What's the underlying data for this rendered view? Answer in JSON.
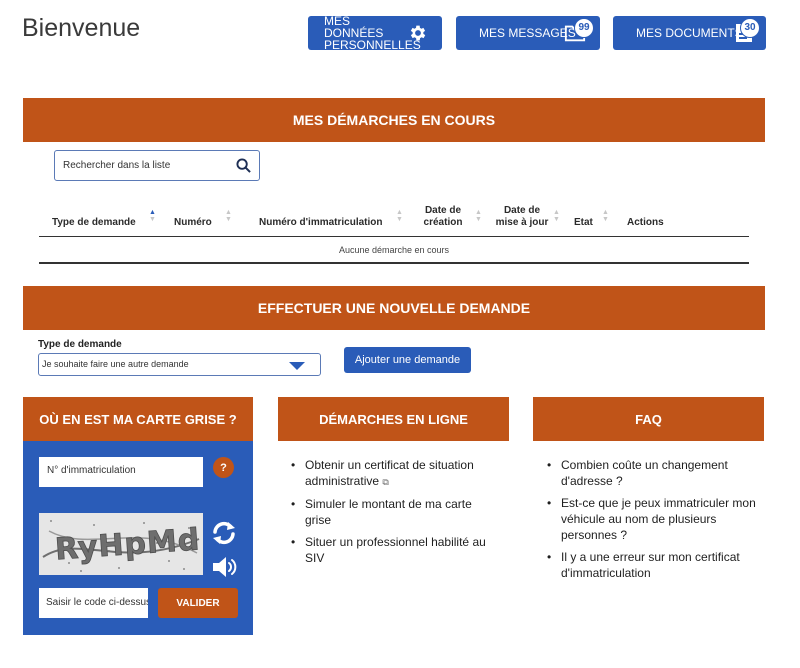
{
  "page": {
    "title": "Bienvenue"
  },
  "header_buttons": {
    "perso": {
      "label": "MES DONNÉES PERSONNELLES",
      "icon": "gear-icon"
    },
    "messages": {
      "label": "MES MESSAGES",
      "badge": "99",
      "icon": "folder-icon"
    },
    "documents": {
      "label": "MES DOCUMENTS",
      "badge": "30",
      "icon": "document-icon"
    }
  },
  "demarches": {
    "title": "MES DÉMARCHES EN COURS",
    "search_placeholder": "Rechercher dans la liste",
    "columns": [
      "Type de demande",
      "Numéro",
      "Numéro d'immatriculation",
      "Date de création",
      "Date de mise à jour",
      "Etat",
      "Actions"
    ],
    "empty_message": "Aucune démarche en cours"
  },
  "nouvelle": {
    "title": "EFFECTUER UNE NOUVELLE DEMANDE",
    "type_label": "Type de demande",
    "type_selected": "Je souhaite faire une autre demande",
    "add_button": "Ajouter une demande"
  },
  "carte_grise": {
    "title": "OÙ EN EST MA CARTE GRISE ?",
    "immat_placeholder": "N° d'immatriculation",
    "help_label": "?",
    "captcha_text": "RyHpMd",
    "code_placeholder": "Saisir le code ci-dessus",
    "validate_button": "VALIDER"
  },
  "en_ligne": {
    "title": "DÉMARCHES EN LIGNE",
    "items": [
      "Obtenir un certificat de situation administrative",
      "Simuler le montant de ma carte grise",
      "Situer un professionnel habilité au SIV"
    ]
  },
  "faq": {
    "title": "FAQ",
    "items": [
      "Combien coûte un changement d'adresse ?",
      "Est-ce que je peux immatriculer mon véhicule au nom de plusieurs personnes ?",
      "Il y a une erreur sur mon certificat d'immatriculation"
    ]
  },
  "colors": {
    "primary": "#2a5cb8",
    "accent": "#c05418"
  }
}
